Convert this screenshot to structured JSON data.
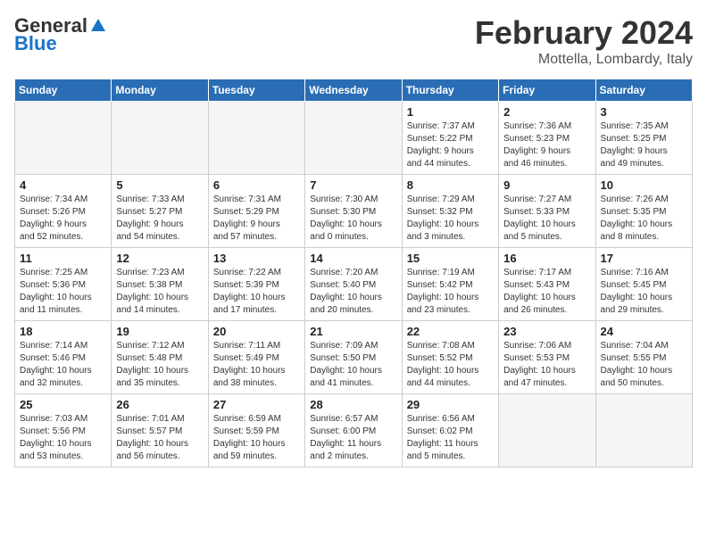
{
  "logo": {
    "general": "General",
    "blue": "Blue"
  },
  "title": {
    "month_year": "February 2024",
    "location": "Mottella, Lombardy, Italy"
  },
  "days_of_week": [
    "Sunday",
    "Monday",
    "Tuesday",
    "Wednesday",
    "Thursday",
    "Friday",
    "Saturday"
  ],
  "weeks": [
    [
      {
        "day": "",
        "content": ""
      },
      {
        "day": "",
        "content": ""
      },
      {
        "day": "",
        "content": ""
      },
      {
        "day": "",
        "content": ""
      },
      {
        "day": "1",
        "content": "Sunrise: 7:37 AM\nSunset: 5:22 PM\nDaylight: 9 hours\nand 44 minutes."
      },
      {
        "day": "2",
        "content": "Sunrise: 7:36 AM\nSunset: 5:23 PM\nDaylight: 9 hours\nand 46 minutes."
      },
      {
        "day": "3",
        "content": "Sunrise: 7:35 AM\nSunset: 5:25 PM\nDaylight: 9 hours\nand 49 minutes."
      }
    ],
    [
      {
        "day": "4",
        "content": "Sunrise: 7:34 AM\nSunset: 5:26 PM\nDaylight: 9 hours\nand 52 minutes."
      },
      {
        "day": "5",
        "content": "Sunrise: 7:33 AM\nSunset: 5:27 PM\nDaylight: 9 hours\nand 54 minutes."
      },
      {
        "day": "6",
        "content": "Sunrise: 7:31 AM\nSunset: 5:29 PM\nDaylight: 9 hours\nand 57 minutes."
      },
      {
        "day": "7",
        "content": "Sunrise: 7:30 AM\nSunset: 5:30 PM\nDaylight: 10 hours\nand 0 minutes."
      },
      {
        "day": "8",
        "content": "Sunrise: 7:29 AM\nSunset: 5:32 PM\nDaylight: 10 hours\nand 3 minutes."
      },
      {
        "day": "9",
        "content": "Sunrise: 7:27 AM\nSunset: 5:33 PM\nDaylight: 10 hours\nand 5 minutes."
      },
      {
        "day": "10",
        "content": "Sunrise: 7:26 AM\nSunset: 5:35 PM\nDaylight: 10 hours\nand 8 minutes."
      }
    ],
    [
      {
        "day": "11",
        "content": "Sunrise: 7:25 AM\nSunset: 5:36 PM\nDaylight: 10 hours\nand 11 minutes."
      },
      {
        "day": "12",
        "content": "Sunrise: 7:23 AM\nSunset: 5:38 PM\nDaylight: 10 hours\nand 14 minutes."
      },
      {
        "day": "13",
        "content": "Sunrise: 7:22 AM\nSunset: 5:39 PM\nDaylight: 10 hours\nand 17 minutes."
      },
      {
        "day": "14",
        "content": "Sunrise: 7:20 AM\nSunset: 5:40 PM\nDaylight: 10 hours\nand 20 minutes."
      },
      {
        "day": "15",
        "content": "Sunrise: 7:19 AM\nSunset: 5:42 PM\nDaylight: 10 hours\nand 23 minutes."
      },
      {
        "day": "16",
        "content": "Sunrise: 7:17 AM\nSunset: 5:43 PM\nDaylight: 10 hours\nand 26 minutes."
      },
      {
        "day": "17",
        "content": "Sunrise: 7:16 AM\nSunset: 5:45 PM\nDaylight: 10 hours\nand 29 minutes."
      }
    ],
    [
      {
        "day": "18",
        "content": "Sunrise: 7:14 AM\nSunset: 5:46 PM\nDaylight: 10 hours\nand 32 minutes."
      },
      {
        "day": "19",
        "content": "Sunrise: 7:12 AM\nSunset: 5:48 PM\nDaylight: 10 hours\nand 35 minutes."
      },
      {
        "day": "20",
        "content": "Sunrise: 7:11 AM\nSunset: 5:49 PM\nDaylight: 10 hours\nand 38 minutes."
      },
      {
        "day": "21",
        "content": "Sunrise: 7:09 AM\nSunset: 5:50 PM\nDaylight: 10 hours\nand 41 minutes."
      },
      {
        "day": "22",
        "content": "Sunrise: 7:08 AM\nSunset: 5:52 PM\nDaylight: 10 hours\nand 44 minutes."
      },
      {
        "day": "23",
        "content": "Sunrise: 7:06 AM\nSunset: 5:53 PM\nDaylight: 10 hours\nand 47 minutes."
      },
      {
        "day": "24",
        "content": "Sunrise: 7:04 AM\nSunset: 5:55 PM\nDaylight: 10 hours\nand 50 minutes."
      }
    ],
    [
      {
        "day": "25",
        "content": "Sunrise: 7:03 AM\nSunset: 5:56 PM\nDaylight: 10 hours\nand 53 minutes."
      },
      {
        "day": "26",
        "content": "Sunrise: 7:01 AM\nSunset: 5:57 PM\nDaylight: 10 hours\nand 56 minutes."
      },
      {
        "day": "27",
        "content": "Sunrise: 6:59 AM\nSunset: 5:59 PM\nDaylight: 10 hours\nand 59 minutes."
      },
      {
        "day": "28",
        "content": "Sunrise: 6:57 AM\nSunset: 6:00 PM\nDaylight: 11 hours\nand 2 minutes."
      },
      {
        "day": "29",
        "content": "Sunrise: 6:56 AM\nSunset: 6:02 PM\nDaylight: 11 hours\nand 5 minutes."
      },
      {
        "day": "",
        "content": ""
      },
      {
        "day": "",
        "content": ""
      }
    ]
  ]
}
